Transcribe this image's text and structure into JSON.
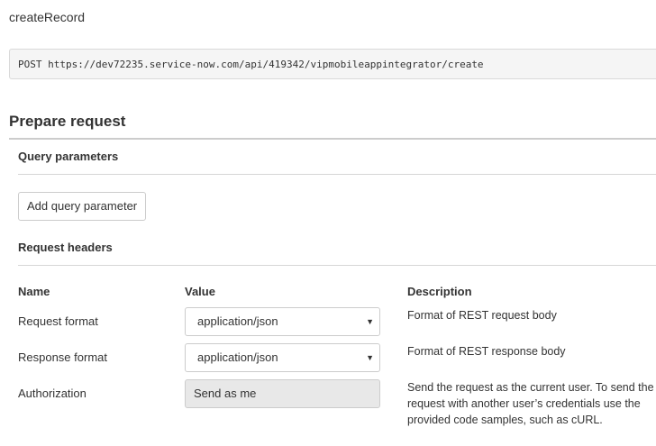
{
  "method": {
    "title": "createRecord",
    "endpoint": "POST https://dev72235.service-now.com/api/419342/vipmobileappintegrator/create"
  },
  "prepare_request": {
    "heading": "Prepare request",
    "query_parameters": {
      "heading": "Query parameters",
      "add_button_label": "Add query parameter"
    },
    "request_headers": {
      "heading": "Request headers",
      "columns": {
        "name": "Name",
        "value": "Value",
        "description": "Description"
      },
      "rows": [
        {
          "name": "Request format",
          "value": "application/json",
          "description": "Format of REST request body"
        },
        {
          "name": "Response format",
          "value": "application/json",
          "description": "Format of REST response body"
        },
        {
          "name": "Authorization",
          "value": "Send as me",
          "description": "Send the request as the current user. To send the request with another user’s credentials use the provided code samples, such as cURL."
        }
      ]
    }
  },
  "icons": {
    "dropdown_arrow": "▼"
  }
}
